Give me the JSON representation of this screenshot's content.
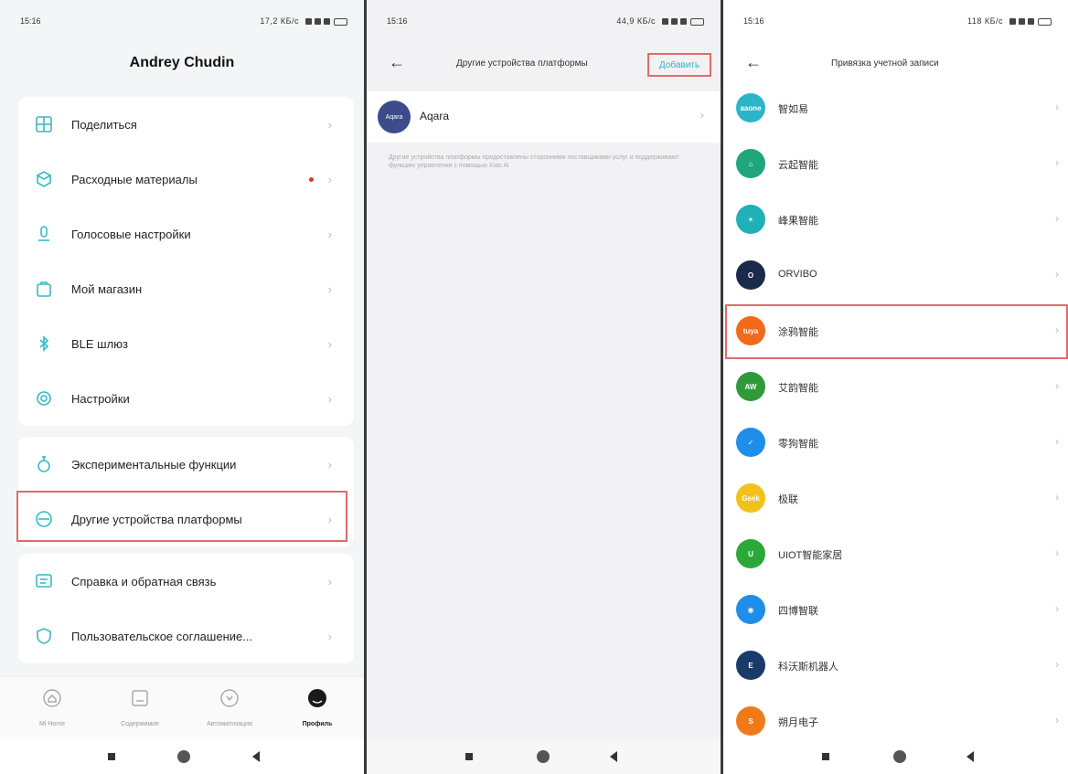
{
  "screen1": {
    "status": {
      "time": "15:16",
      "speed": "17,2 КБ/с"
    },
    "title": "Andrey Chudin",
    "menu_group1": [
      {
        "label": "Поделиться",
        "icon": "share-icon"
      },
      {
        "label": "Расходные материалы",
        "icon": "consumables-icon",
        "badge": true
      },
      {
        "label": "Голосовые настройки",
        "icon": "voice-icon"
      },
      {
        "label": "Мой магазин",
        "icon": "shop-icon"
      },
      {
        "label": "BLE шлюз",
        "icon": "bluetooth-icon"
      },
      {
        "label": "Настройки",
        "icon": "settings-icon"
      }
    ],
    "menu_group2": [
      {
        "label": "Экспериментальные функции",
        "icon": "flask-icon"
      },
      {
        "label": "Другие устройства платформы",
        "icon": "platform-icon"
      }
    ],
    "menu_group3": [
      {
        "label": "Справка и обратная связь",
        "icon": "help-icon"
      },
      {
        "label": "Пользовательское соглашение...",
        "icon": "agreement-icon"
      }
    ],
    "tabs": [
      {
        "label": "Mi Home"
      },
      {
        "label": "Содержимое"
      },
      {
        "label": "Автоматизация"
      },
      {
        "label": "Профиль"
      }
    ],
    "chevron": "›"
  },
  "screen2": {
    "status": {
      "time": "15:16",
      "speed": "44,9 КБ/с"
    },
    "back": "←",
    "title": "Другие устройства платформы",
    "add_button": "Добавить",
    "device": {
      "logo_text": "Aqara",
      "label": "Aqara"
    },
    "note": "Другие устройства платформы предоставлены сторонними поставщиками услуг и поддерживают функцию управления с помощью Xiao Ai"
  },
  "screen3": {
    "status": {
      "time": "15:16",
      "speed": "118 КБ/с"
    },
    "back": "←",
    "title": "Привязка учетной записи",
    "platforms": [
      {
        "name": "智如易",
        "logo_text": "aaone",
        "color": "#2bb5c8"
      },
      {
        "name": "云起智能",
        "logo_text": "⌂",
        "color": "#1fa67a"
      },
      {
        "name": "峰果智能",
        "logo_text": "✶",
        "color": "#20b0b8"
      },
      {
        "name": "ORVIBO",
        "logo_text": "O",
        "color": "#1a2a4a"
      },
      {
        "name": "涂鸦智能",
        "logo_text": "tuya",
        "color": "#f26a1b"
      },
      {
        "name": "艾韵智能",
        "logo_text": "AW",
        "color": "#2f9a3a"
      },
      {
        "name": "零狗智能",
        "logo_text": "✓",
        "color": "#1e8ee8"
      },
      {
        "name": "极联",
        "logo_text": "Geek",
        "color": "#f2c21a"
      },
      {
        "name": "UIOT智能家居",
        "logo_text": "U",
        "color": "#2ca83a"
      },
      {
        "name": "四博智联",
        "logo_text": "◉",
        "color": "#1e8ee8"
      },
      {
        "name": "科沃斯机器人",
        "logo_text": "E",
        "color": "#1a3a6a"
      },
      {
        "name": "朔月电子",
        "logo_text": "S",
        "color": "#f07a1a"
      }
    ]
  }
}
